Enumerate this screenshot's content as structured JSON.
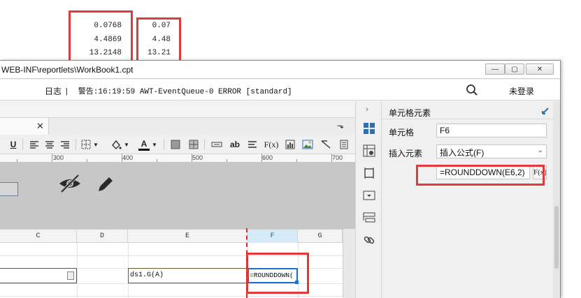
{
  "annotations": {
    "raw_values": [
      "0.0768",
      "4.4869",
      "13.2148"
    ],
    "rounded_values": [
      "0.07",
      "4.48",
      "13.21"
    ]
  },
  "window": {
    "title": "WEB-INF\\reportlets\\WorkBook1.cpt",
    "buttons": [
      "—",
      "▢",
      "✕"
    ]
  },
  "logbar": {
    "log_label": "日志",
    "message": "|  警告:16:19:59 AWT-EventQueue-0 ERROR [standard]",
    "login": "未登录"
  },
  "toolbar": {
    "underline": "U",
    "text_ab": "ab",
    "formula": "F(x)"
  },
  "ruler": {
    "labels": [
      "300",
      "400",
      "500",
      "600",
      "700"
    ]
  },
  "columns": [
    "C",
    "D",
    "E",
    "F",
    "G"
  ],
  "cells": {
    "e_value": "ds1.G(A)",
    "f_value": "=ROUNDDOWN("
  },
  "panel": {
    "title": "单元格元素",
    "cell_label": "单元格",
    "cell_value": "F6",
    "insert_label": "插入元素",
    "insert_value": "插入公式(F)",
    "formula_value": "=ROUNDDOWN(E6,2)",
    "formula_btn": "F(x)"
  },
  "colors": {
    "highlight_red": "#e23a3a",
    "selection_blue": "#1e6fd0"
  }
}
